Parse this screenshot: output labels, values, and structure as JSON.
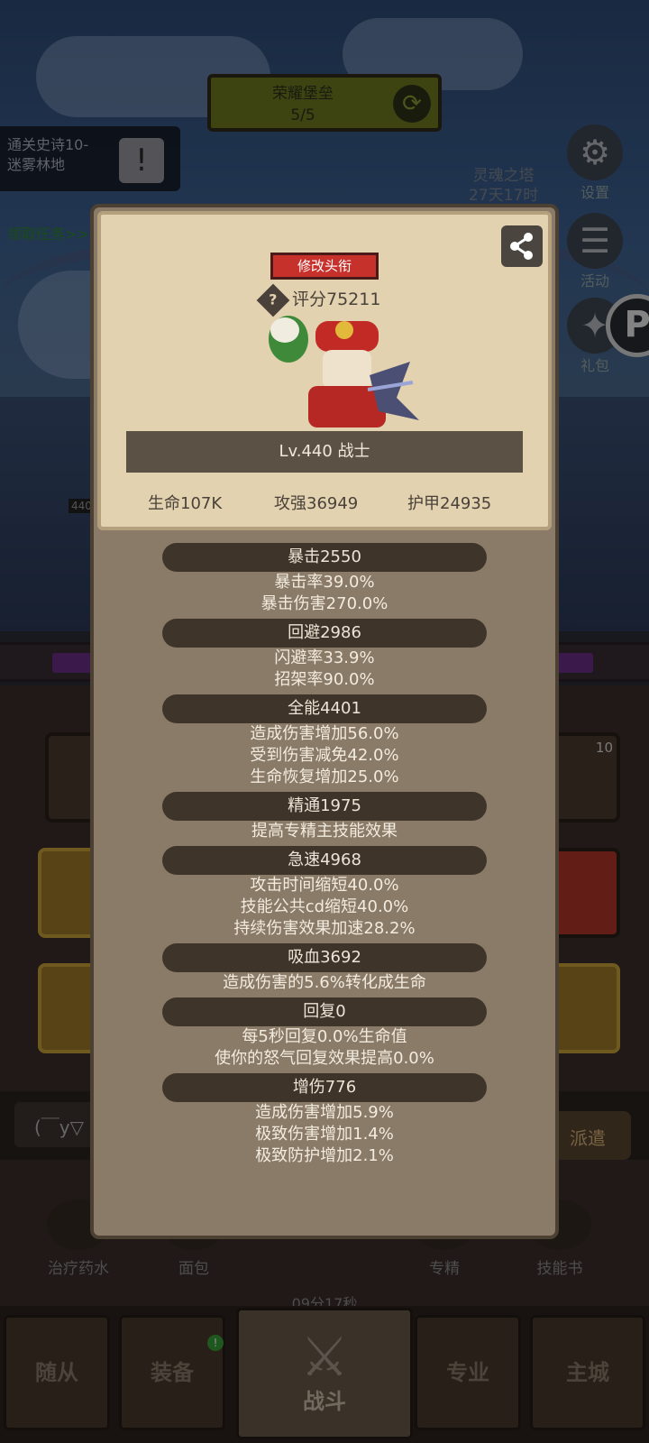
{
  "hud": {
    "banner_title": "荣耀堡垒",
    "banner_progress": "5/5",
    "quest_line1": "通关史诗10-",
    "quest_line2": "迷雾林地",
    "quest_link": "领取任务>>",
    "soul_tower": "灵魂之塔",
    "soul_tower_timer": "27天17时",
    "settings_label": "设置",
    "activity_label": "活动",
    "gift_label": "礼包",
    "level_tag": "440",
    "slot_badge": "10"
  },
  "chat": {
    "emote": "(￣y▽"
  },
  "auto_button": "派遣",
  "quick_items": {
    "potion": "治疗药水",
    "bread": "面包",
    "timer": "09分17秒",
    "mastery": "专精",
    "skillbook": "技能书"
  },
  "nav": {
    "follower": "随从",
    "equipment": "装备",
    "equipment_badge": "!",
    "battle": "战斗",
    "profession": "专业",
    "city": "主城"
  },
  "panel": {
    "rename_button": "修改头衔",
    "help": "?",
    "score": "评分75211",
    "level_class": "Lv.440 战士",
    "hp": "生命107K",
    "attack": "攻强36949",
    "armor": "护甲24935",
    "sections": {
      "crit": {
        "header": "暴击2550",
        "lines": [
          "暴击率39.0%",
          "暴击伤害270.0%"
        ]
      },
      "dodge": {
        "header": "回避2986",
        "lines": [
          "闪避率33.9%",
          "招架率90.0%"
        ]
      },
      "versatility": {
        "header": "全能4401",
        "lines": [
          "造成伤害增加56.0%",
          "受到伤害减免42.0%",
          "生命恢复增加25.0%"
        ]
      },
      "mastery": {
        "header": "精通1975",
        "lines": [
          "提高专精主技能效果"
        ]
      },
      "haste": {
        "header": "急速4968",
        "lines": [
          "攻击时间缩短40.0%",
          "技能公共cd缩短40.0%",
          "持续伤害效果加速28.2%"
        ]
      },
      "lifesteal": {
        "header": "吸血3692",
        "lines": [
          "造成伤害的5.6%转化成生命"
        ]
      },
      "regen": {
        "header": "回复0",
        "lines": [
          "每5秒回复0.0%生命值",
          "使你的怒气回复效果提高0.0%"
        ]
      },
      "dmgboost": {
        "header": "增伤776",
        "lines": [
          "造成伤害增加5.9%",
          "极致伤害增加1.4%",
          "极致防护增加2.1%"
        ]
      }
    }
  },
  "colors": {
    "panel": "#8a7a68",
    "panel_top": "#e2d2b0",
    "header_pill": "#3f342a",
    "rename_red": "#c7312c",
    "green_banner": "#6f7d22"
  }
}
